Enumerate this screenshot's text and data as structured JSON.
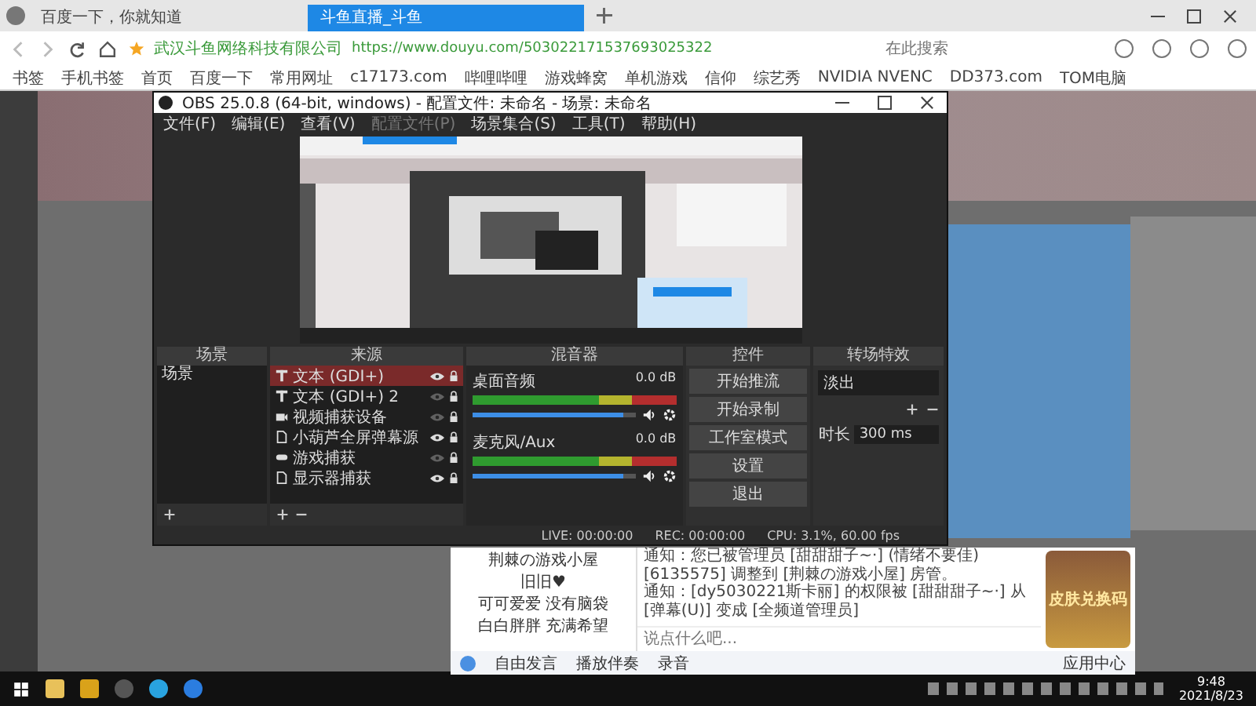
{
  "browser": {
    "tabs": [
      {
        "label": "百度一下，你就知道",
        "selected": false
      },
      {
        "label": "斗鱼直播_斗鱼",
        "selected": true
      }
    ],
    "site_name": "武汉斗鱼网络科技有限公司",
    "url": "https://www.douyu.com/503022171537693025322",
    "search_placeholder": "在此搜索",
    "bookmarks": [
      "书签",
      "手机书签",
      "首页",
      "百度一下",
      "常用网址",
      "c17173.com",
      "哔哩哔哩",
      "游戏蜂窝",
      "单机游戏",
      "信仰",
      "综艺秀",
      "NVIDIA NVENC",
      "DD373.com",
      "TOM电脑"
    ]
  },
  "obs": {
    "title": "OBS 25.0.8 (64-bit, windows) - 配置文件: 未命名 - 场景: 未命名",
    "menu": [
      {
        "label": "文件(F)",
        "disabled": false
      },
      {
        "label": "编辑(E)",
        "disabled": false
      },
      {
        "label": "查看(V)",
        "disabled": false
      },
      {
        "label": "配置文件(P)",
        "disabled": true
      },
      {
        "label": "场景集合(S)",
        "disabled": false
      },
      {
        "label": "工具(T)",
        "disabled": false
      },
      {
        "label": "帮助(H)",
        "disabled": false
      }
    ],
    "scenes": {
      "title": "场景",
      "items": [
        {
          "label": "场景",
          "selected": false
        }
      ]
    },
    "sources": {
      "title": "来源",
      "items": [
        {
          "label": "文本 (GDI+)",
          "kind": "text",
          "selected": true,
          "visible": true
        },
        {
          "label": "文本 (GDI+) 2",
          "kind": "text",
          "selected": false,
          "visible": false
        },
        {
          "label": "视频捕获设备",
          "kind": "camera",
          "selected": false,
          "visible": false
        },
        {
          "label": "小葫芦全屏弹幕源",
          "kind": "file",
          "selected": false,
          "visible": true
        },
        {
          "label": "游戏捕获",
          "kind": "game",
          "selected": false,
          "visible": false
        },
        {
          "label": "显示器捕获",
          "kind": "file",
          "selected": false,
          "visible": true
        }
      ]
    },
    "mixer": {
      "title": "混音器",
      "channels": [
        {
          "name": "桌面音频",
          "reading": "0.0 dB",
          "level": 0.93
        },
        {
          "name": "麦克风/Aux",
          "reading": "0.0 dB",
          "level": 0.93
        }
      ]
    },
    "controls": {
      "title": "控件",
      "buttons": [
        "开始推流",
        "开始录制",
        "工作室模式",
        "设置",
        "退出"
      ]
    },
    "transitions": {
      "title": "转场特效",
      "value": "淡出",
      "duration_label": "时长",
      "duration": "300 ms"
    },
    "status": {
      "live": "LIVE: 00:00:00",
      "rec": "REC: 00:00:00",
      "cpu": "CPU: 3.1%, 60.00 fps"
    }
  },
  "chat": {
    "users": [
      "荆棘の游戏小屋",
      "旧旧♥",
      "可可爱爱 没有脑袋",
      "白白胖胖 充满希望"
    ],
    "messages": [
      "通知：您已被管理员 [甜甜甜子~·] (情绪不要佳) [6135575] 调整到 [荆棘の游戏小屋] 房管。",
      "通知：[dy5030221斯卡丽] 的权限被 [甜甜甜子~·] 从 [弹幕(U)] 变成 [全频道管理员]"
    ],
    "placeholder": "说点什么吧...",
    "tools": [
      "自由发言",
      "播放伴奏",
      "录音"
    ],
    "app_center": "应用中心",
    "promo": "皮肤兑换码"
  },
  "taskbar": {
    "time": "9:48",
    "date": "2021/8/23"
  }
}
